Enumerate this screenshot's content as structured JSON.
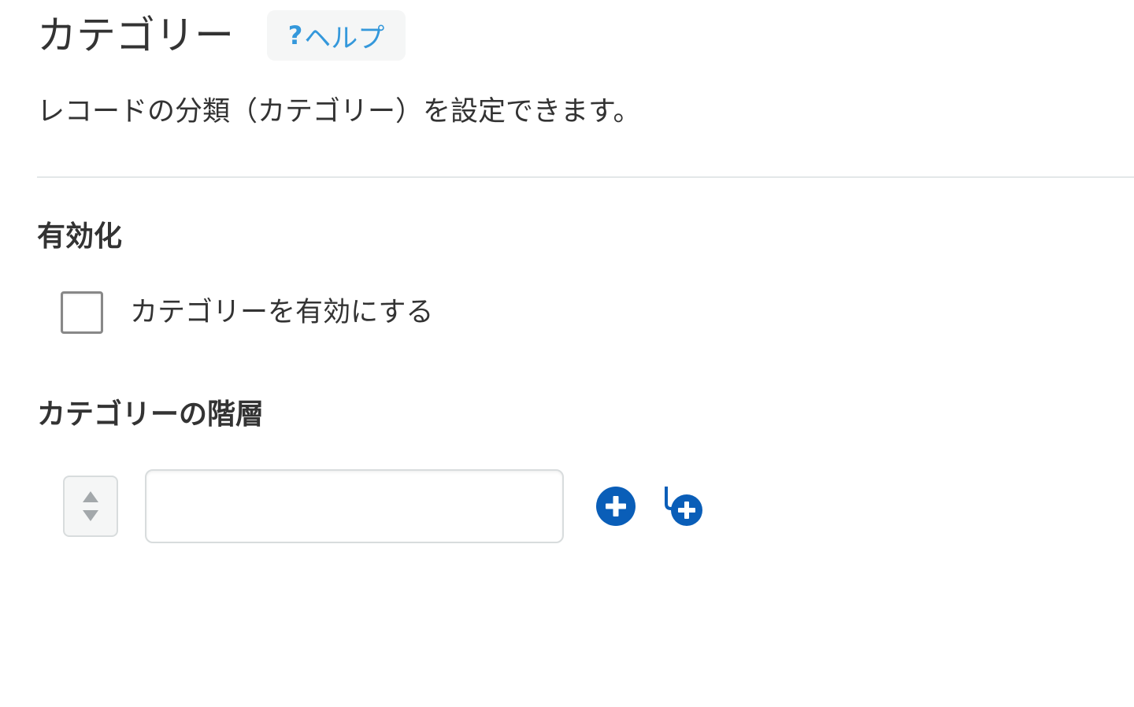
{
  "header": {
    "title": "カテゴリー",
    "help_label": "ヘルプ",
    "help_icon_glyph": "?"
  },
  "description": "レコードの分類（カテゴリー）を設定できます。",
  "enable_section": {
    "heading": "有効化",
    "checkbox_label": "カテゴリーを有効にする",
    "checked": false
  },
  "hierarchy_section": {
    "heading": "カテゴリーの階層",
    "items": [
      {
        "value": "",
        "placeholder": ""
      }
    ]
  },
  "colors": {
    "accent_blue": "#3498db",
    "action_blue": "#0a5eb8",
    "text": "#333333",
    "divider": "#e3e7e8"
  },
  "icons": {
    "sort": "sort-arrows-icon",
    "add": "add-circle-icon",
    "add_child": "add-child-icon"
  }
}
